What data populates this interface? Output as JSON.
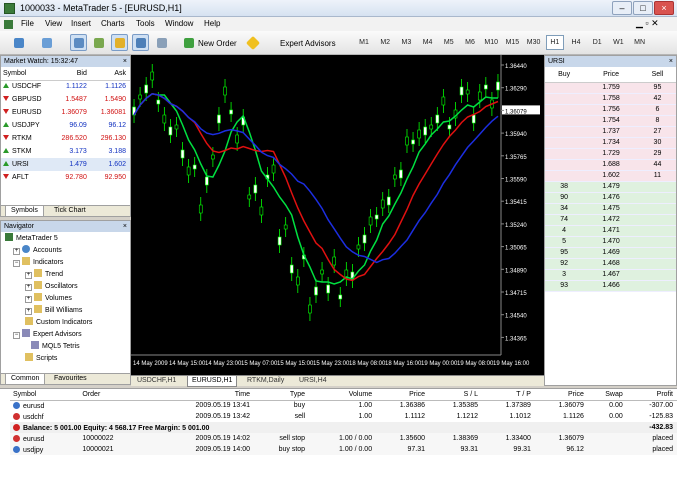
{
  "window": {
    "title": "1000033 - MetaTrader 5 - [EURUSD,H1]"
  },
  "menu": [
    "File",
    "View",
    "Insert",
    "Charts",
    "Tools",
    "Window",
    "Help"
  ],
  "toolbar": {
    "new_order": "New Order",
    "expert_advisors": "Expert Advisors",
    "timeframes": [
      "M1",
      "M2",
      "M3",
      "M4",
      "M5",
      "M6",
      "M10",
      "M15",
      "M30",
      "H1",
      "H4",
      "D1",
      "W1",
      "MN"
    ],
    "active_timeframe": "H1"
  },
  "market_watch": {
    "title": "Market Watch: 15:32:47",
    "headers": [
      "Symbol",
      "Bid",
      "Ask"
    ],
    "rows": [
      {
        "symbol": "USDCHF",
        "bid": "1.1122",
        "ask": "1.1126",
        "dir": "up"
      },
      {
        "symbol": "GBPUSD",
        "bid": "1.5487",
        "ask": "1.5490",
        "dir": "dn"
      },
      {
        "symbol": "EURUSD",
        "bid": "1.36079",
        "ask": "1.36081",
        "dir": "dn"
      },
      {
        "symbol": "USDJPY",
        "bid": "96.09",
        "ask": "96.12",
        "dir": "up"
      },
      {
        "symbol": "RTKM",
        "bid": "286.520",
        "ask": "296.130",
        "dir": "dn"
      },
      {
        "symbol": "STKM",
        "bid": "3.173",
        "ask": "3.188",
        "dir": "up"
      },
      {
        "symbol": "URSI",
        "bid": "1.479",
        "ask": "1.602",
        "dir": "up"
      },
      {
        "symbol": "AFLT",
        "bid": "92.780",
        "ask": "92.950",
        "dir": "dn"
      }
    ],
    "tabs": [
      "Symbols",
      "Tick Chart"
    ]
  },
  "navigator": {
    "title": "Navigator",
    "items": [
      "MetaTrader 5",
      "Accounts",
      "Indicators",
      "Trend",
      "Oscillators",
      "Volumes",
      "Bill Williams",
      "Custom Indicators",
      "Expert Advisors",
      "MQL5 Tetris",
      "Scripts"
    ],
    "tabs": [
      "Common",
      "Favourites"
    ]
  },
  "chart": {
    "price_labels": [
      "1.36440",
      "1.36290",
      "1.36079",
      "1.35940",
      "1.35765",
      "1.35590",
      "1.35415",
      "1.35240",
      "1.35065",
      "1.34890",
      "1.34715",
      "1.34540",
      "1.34365"
    ],
    "current_price": "1.36079",
    "time_labels": [
      "14 May 2009",
      "14 May 15:00",
      "14 May 23:00",
      "15 May 07:00",
      "15 May 15:00",
      "15 May 23:00",
      "18 May 08:00",
      "18 May 16:00",
      "19 May 00:00",
      "19 May 08:00",
      "19 May 16:00"
    ],
    "tabs": [
      "USDCHF,H1",
      "EURUSD,H1",
      "RTKM,Daily",
      "URSI,H4"
    ],
    "active_tab": "EURUSD,H1",
    "colors": {
      "ma_green": "#00e040",
      "ma_red": "#e01010",
      "ma_blue": "#1c2ee0",
      "candles": "#00ff00"
    }
  },
  "depth": {
    "symbol": "URSI",
    "headers": [
      "Buy",
      "Price",
      "Sell"
    ],
    "asks": [
      [
        "1.759",
        "95"
      ],
      [
        "1.758",
        "42"
      ],
      [
        "1.756",
        "6"
      ],
      [
        "1.754",
        "8"
      ],
      [
        "1.737",
        "27"
      ],
      [
        "1.734",
        "30"
      ],
      [
        "1.729",
        "29"
      ],
      [
        "1.688",
        "44"
      ],
      [
        "1.602",
        "11"
      ]
    ],
    "bids": [
      [
        "38",
        "1.479"
      ],
      [
        "90",
        "1.476"
      ],
      [
        "34",
        "1.475"
      ],
      [
        "74",
        "1.472"
      ],
      [
        "4",
        "1.471"
      ],
      [
        "5",
        "1.470"
      ],
      [
        "95",
        "1.469"
      ],
      [
        "92",
        "1.468"
      ],
      [
        "3",
        "1.467"
      ],
      [
        "93",
        "1.466"
      ]
    ]
  },
  "orders": {
    "headers": [
      "Symbol",
      "Order",
      "Time",
      "Type",
      "Volume",
      "Price",
      "S / L",
      "T / P",
      "Price",
      "Swap",
      "Profit"
    ],
    "rows": [
      {
        "symbol": "eurusd",
        "order": "",
        "time": "2009.05.19 13:41",
        "type": "buy",
        "volume": "1.00",
        "price": "1.36386",
        "sl": "1.35385",
        "tp": "1.37389",
        "cur": "1.36079",
        "swap": "0.00",
        "profit": "-307.00"
      },
      {
        "symbol": "usdchf",
        "order": "",
        "time": "2009.05.19 13:42",
        "type": "sell",
        "volume": "1.00",
        "price": "1.1112",
        "sl": "1.1212",
        "tp": "1.1012",
        "cur": "1.1126",
        "swap": "0.00",
        "profit": "-125.83"
      }
    ],
    "balance": "Balance: 5 001.00  Equity: 4 568.17  Free Margin: 5 001.00",
    "balance_profit": "-432.83",
    "pending": [
      {
        "symbol": "eurusd",
        "order": "10000022",
        "time": "2009.05.19 14:02",
        "type": "sell stop",
        "volume": "1.00 / 0.00",
        "price": "1.35600",
        "sl": "1.38369",
        "tp": "1.33400",
        "cur": "1.36079",
        "swap": "",
        "profit": "placed"
      },
      {
        "symbol": "usdjpy",
        "order": "10000021",
        "time": "2009.05.19 14:00",
        "type": "buy stop",
        "volume": "1.00 / 0.00",
        "price": "97.31",
        "sl": "93.31",
        "tp": "99.31",
        "cur": "96.12",
        "swap": "",
        "profit": "placed"
      }
    ]
  }
}
